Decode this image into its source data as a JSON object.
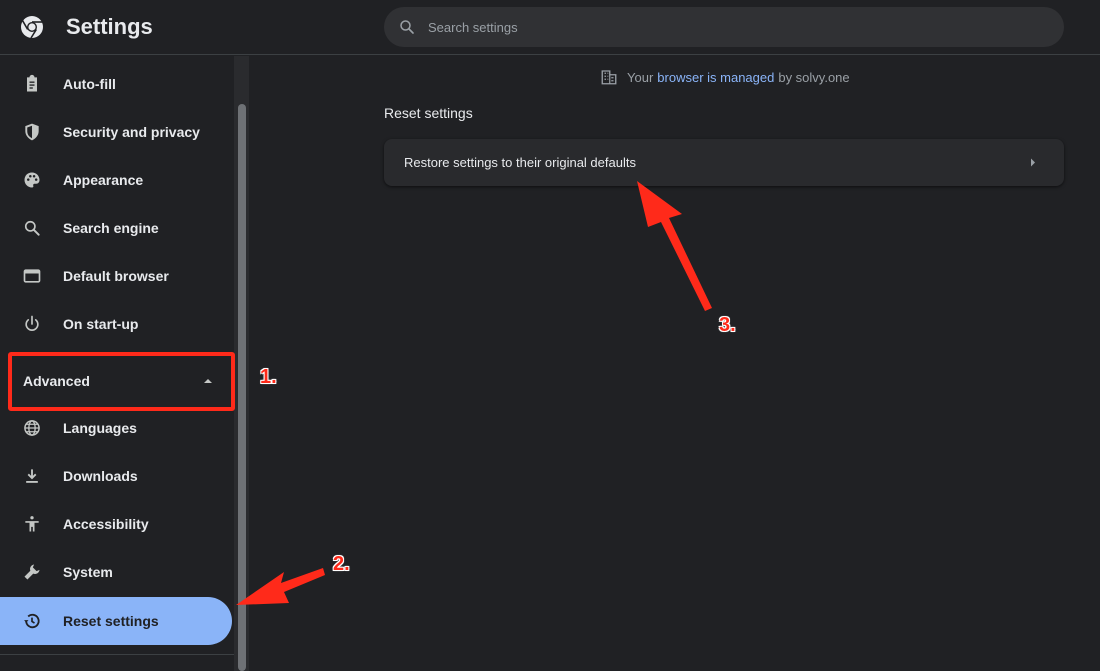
{
  "header": {
    "title": "Settings",
    "search_placeholder": "Search settings"
  },
  "sidebar": {
    "items": [
      {
        "label": "Auto-fill",
        "icon": "clipboard-icon"
      },
      {
        "label": "Security and privacy",
        "icon": "shield-icon"
      },
      {
        "label": "Appearance",
        "icon": "palette-icon"
      },
      {
        "label": "Search engine",
        "icon": "search-icon"
      },
      {
        "label": "Default browser",
        "icon": "browser-window-icon"
      },
      {
        "label": "On start-up",
        "icon": "power-icon"
      }
    ],
    "advanced_label": "Advanced",
    "advanced_items": [
      {
        "label": "Languages",
        "icon": "globe-icon"
      },
      {
        "label": "Downloads",
        "icon": "download-icon"
      },
      {
        "label": "Accessibility",
        "icon": "accessibility-icon"
      },
      {
        "label": "System",
        "icon": "wrench-icon"
      },
      {
        "label": "Reset settings",
        "icon": "restore-icon",
        "active": true
      }
    ]
  },
  "main": {
    "managed_prefix": "Your",
    "managed_link": "browser is managed",
    "managed_suffix": "by solvy.one",
    "section_title": "Reset settings",
    "restore_label": "Restore settings to their original defaults"
  },
  "annotations": {
    "step1": "1.",
    "step2": "2.",
    "step3": "3."
  },
  "colors": {
    "background": "#202124",
    "accent": "#8ab4f8",
    "annotation": "#ff2a1a"
  }
}
